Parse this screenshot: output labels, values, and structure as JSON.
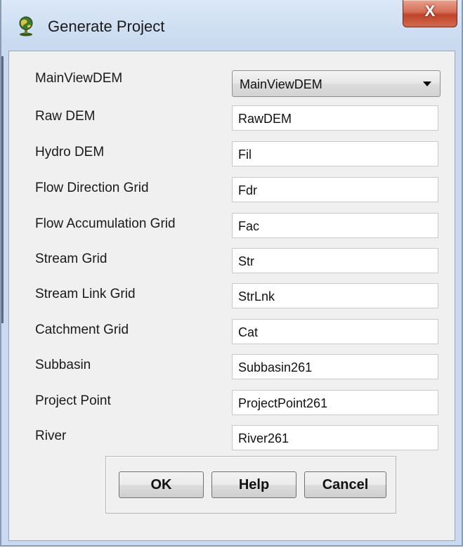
{
  "window": {
    "title": "Generate Project",
    "close_label": "X"
  },
  "form": {
    "main_view_dem": {
      "label": "MainViewDEM",
      "selected": "MainViewDEM"
    },
    "fields": [
      {
        "label": "Raw DEM",
        "value": "RawDEM"
      },
      {
        "label": "Hydro DEM",
        "value": "Fil"
      },
      {
        "label": "Flow Direction Grid",
        "value": "Fdr"
      },
      {
        "label": "Flow Accumulation Grid",
        "value": "Fac"
      },
      {
        "label": "Stream Grid",
        "value": "Str"
      },
      {
        "label": "Stream Link Grid",
        "value": "StrLnk"
      },
      {
        "label": "Catchment Grid",
        "value": "Cat"
      },
      {
        "label": "Subbasin",
        "value": "Subbasin261"
      },
      {
        "label": "Project Point",
        "value": "ProjectPoint261"
      },
      {
        "label": "River",
        "value": "River261"
      }
    ]
  },
  "buttons": {
    "ok": "OK",
    "help": "Help",
    "cancel": "Cancel"
  }
}
